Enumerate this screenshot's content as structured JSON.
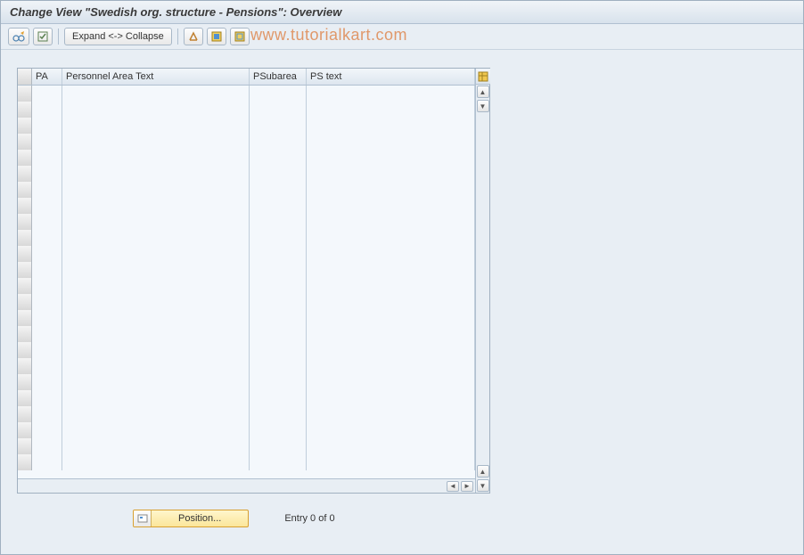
{
  "title": "Change View \"Swedish org. structure - Pensions\": Overview",
  "toolbar": {
    "expand_label": "Expand <-> Collapse"
  },
  "watermark": "www.tutorialkart.com",
  "table": {
    "columns": {
      "pa": "PA",
      "pa_text": "Personnel Area Text",
      "psubarea": "PSubarea",
      "ps_text": "PS text"
    },
    "row_count": 24
  },
  "footer": {
    "position_label": "Position...",
    "entry_text": "Entry 0 of 0"
  }
}
